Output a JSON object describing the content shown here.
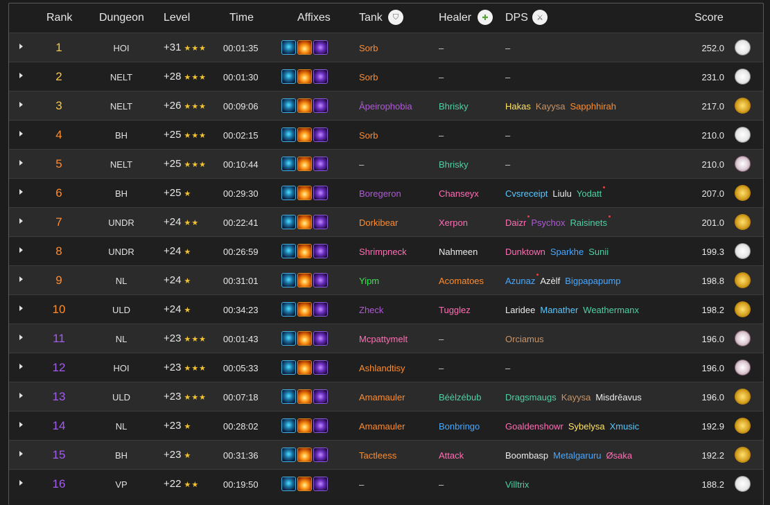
{
  "header": {
    "rank": "Rank",
    "dungeon": "Dungeon",
    "level": "Level",
    "time": "Time",
    "affixes": "Affixes",
    "tank": "Tank",
    "healer": "Healer",
    "dps": "DPS",
    "score": "Score"
  },
  "colors": {
    "rank_top": "#f6c84a",
    "rank_mid": "#ff8c2e",
    "rank_low": "#a25cf0",
    "names": {
      "orange": "#ff8c2e",
      "purple": "#b05ad8",
      "teal": "#4fd1a5",
      "pink": "#ff6eb4",
      "green": "#33e84a",
      "white": "#ececec",
      "blue": "#48a8ff",
      "yellow": "#ffe466",
      "tan": "#c89468",
      "lightblue": "#5ac8ff"
    }
  },
  "rows": [
    {
      "rank": "1",
      "dungeon": "HOI",
      "level": "+31",
      "stars": "★★★",
      "time": "00:01:35",
      "tank": "Sorb",
      "healer": "–",
      "dps": [
        "–"
      ],
      "score": "252.0",
      "faction": "neutral"
    },
    {
      "rank": "2",
      "dungeon": "NELT",
      "level": "+28",
      "stars": "★★★",
      "time": "00:01:30",
      "tank": "Sorb",
      "healer": "–",
      "dps": [
        "–"
      ],
      "score": "231.0",
      "faction": "neutral"
    },
    {
      "rank": "3",
      "dungeon": "NELT",
      "level": "+26",
      "stars": "★★★",
      "time": "00:09:06",
      "tank": "Âpeirophobia",
      "healer": "Bhrisky",
      "dps": [
        "Hakas",
        "Kayysa",
        "Sapphhirah"
      ],
      "score": "217.0",
      "faction": "alliance"
    },
    {
      "rank": "4",
      "dungeon": "BH",
      "level": "+25",
      "stars": "★★★",
      "time": "00:02:15",
      "tank": "Sorb",
      "healer": "–",
      "dps": [
        "–"
      ],
      "score": "210.0",
      "faction": "neutral"
    },
    {
      "rank": "5",
      "dungeon": "NELT",
      "level": "+25",
      "stars": "★★★",
      "time": "00:10:44",
      "tank": "–",
      "healer": "Bhrisky",
      "dps": [
        "–"
      ],
      "score": "210.0",
      "faction": "horde"
    },
    {
      "rank": "6",
      "dungeon": "BH",
      "level": "+25",
      "stars": "★",
      "time": "00:29:30",
      "tank": "Boregeron",
      "healer": "Chanseyx",
      "dps": [
        "Cvsreceipt",
        "Liulu",
        "Yodatt"
      ],
      "score": "207.0",
      "faction": "alliance"
    },
    {
      "rank": "7",
      "dungeon": "UNDR",
      "level": "+24",
      "stars": "★★",
      "time": "00:22:41",
      "tank": "Dorkibear",
      "healer": "Xerpon",
      "dps": [
        "Daizr",
        "Psychox",
        "Raisinets"
      ],
      "score": "201.0",
      "faction": "alliance"
    },
    {
      "rank": "8",
      "dungeon": "UNDR",
      "level": "+24",
      "stars": "★",
      "time": "00:26:59",
      "tank": "Shrimpneck",
      "healer": "Nahmeen",
      "dps": [
        "Dunktown",
        "Sparkhe",
        "Sunii"
      ],
      "score": "199.3",
      "faction": "neutral"
    },
    {
      "rank": "9",
      "dungeon": "NL",
      "level": "+24",
      "stars": "★",
      "time": "00:31:01",
      "tank": "Yipm",
      "healer": "Acomatoes",
      "dps": [
        "Azunaz",
        "Azèlf",
        "Bigpapapump"
      ],
      "score": "198.8",
      "faction": "alliance"
    },
    {
      "rank": "10",
      "dungeon": "ULD",
      "level": "+24",
      "stars": "★",
      "time": "00:34:23",
      "tank": "Zheck",
      "healer": "Tugglez",
      "dps": [
        "Laridee",
        "Manather",
        "Weathermanx"
      ],
      "score": "198.2",
      "faction": "alliance"
    },
    {
      "rank": "11",
      "dungeon": "NL",
      "level": "+23",
      "stars": "★★★",
      "time": "00:01:43",
      "tank": "Mcpattymelt",
      "healer": "–",
      "dps": [
        "Orciamus"
      ],
      "score": "196.0",
      "faction": "horde"
    },
    {
      "rank": "12",
      "dungeon": "HOI",
      "level": "+23",
      "stars": "★★★",
      "time": "00:05:33",
      "tank": "Ashlandtisy",
      "healer": "–",
      "dps": [
        "–"
      ],
      "score": "196.0",
      "faction": "horde"
    },
    {
      "rank": "13",
      "dungeon": "ULD",
      "level": "+23",
      "stars": "★★★",
      "time": "00:07:18",
      "tank": "Amamauler",
      "healer": "Béèlzébub",
      "dps": [
        "Dragsmaugs",
        "Kayysa",
        "Misdrēavus"
      ],
      "score": "196.0",
      "faction": "alliance"
    },
    {
      "rank": "14",
      "dungeon": "NL",
      "level": "+23",
      "stars": "★",
      "time": "00:28:02",
      "tank": "Amamauler",
      "healer": "Bonbringo",
      "dps": [
        "Goaldenshowr",
        "Sybelysa",
        "Xmusic"
      ],
      "score": "192.9",
      "faction": "alliance"
    },
    {
      "rank": "15",
      "dungeon": "BH",
      "level": "+23",
      "stars": "★",
      "time": "00:31:36",
      "tank": "Tactleess",
      "healer": "Attack",
      "dps": [
        "Boombasp",
        "Metalgaruru",
        "Øsaka"
      ],
      "score": "192.2",
      "faction": "alliance"
    },
    {
      "rank": "16",
      "dungeon": "VP",
      "level": "+22",
      "stars": "★★",
      "time": "00:19:50",
      "tank": "–",
      "healer": "–",
      "dps": [
        "Villtrix"
      ],
      "score": "188.2",
      "faction": "neutral"
    }
  ]
}
